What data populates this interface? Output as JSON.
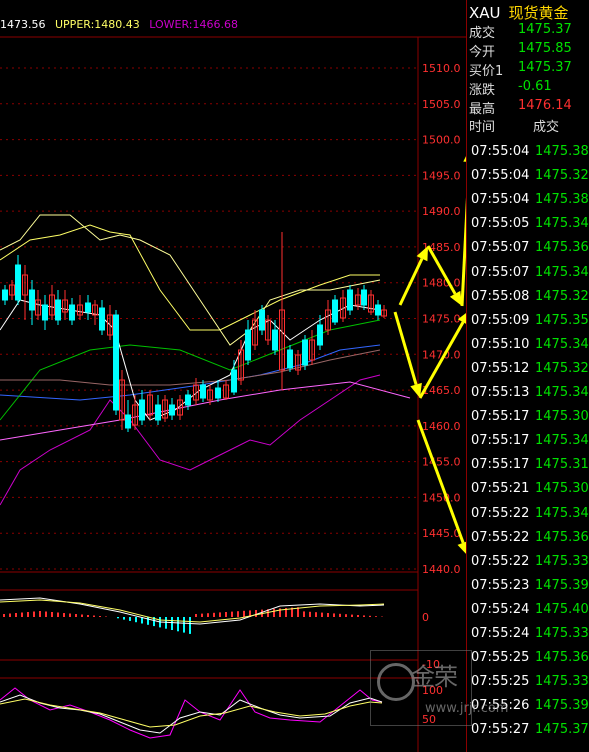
{
  "legend": {
    "mid": "1473.56",
    "upper": "UPPER:1480.43",
    "lower": "LOWER:1466.68"
  },
  "price_axis": [
    "1510.0",
    "1505.0",
    "1500.0",
    "1495.0",
    "1490.0",
    "1485.0",
    "1480.0",
    "1475.0",
    "1470.0",
    "1465.0",
    "1460.0",
    "1455.0",
    "1450.0",
    "1445.0",
    "1440.0"
  ],
  "macd_axis": [
    "0",
    "-10"
  ],
  "kdj_axis": [
    "100",
    "50"
  ],
  "quote": {
    "symbol": "XAU",
    "name": "现货黄金",
    "rows": [
      {
        "label": "成交",
        "value": "1475.37",
        "color": "green"
      },
      {
        "label": "今开",
        "value": "1475.85",
        "color": "green"
      },
      {
        "label": "买价1",
        "value": "1475.37",
        "color": "green"
      },
      {
        "label": "涨跌",
        "value": "-0.61",
        "color": "green"
      },
      {
        "label": "最高",
        "value": "1476.14",
        "color": "red"
      }
    ]
  },
  "trades": {
    "header_time": "时间",
    "header_price": "成交",
    "rows": [
      {
        "time": "07:55:04",
        "price": "1475.38"
      },
      {
        "time": "07:55:04",
        "price": "1475.32"
      },
      {
        "time": "07:55:04",
        "price": "1475.38"
      },
      {
        "time": "07:55:05",
        "price": "1475.34"
      },
      {
        "time": "07:55:07",
        "price": "1475.36"
      },
      {
        "time": "07:55:07",
        "price": "1475.34"
      },
      {
        "time": "07:55:08",
        "price": "1475.32"
      },
      {
        "time": "07:55:09",
        "price": "1475.35"
      },
      {
        "time": "07:55:10",
        "price": "1475.34"
      },
      {
        "time": "07:55:12",
        "price": "1475.32"
      },
      {
        "time": "07:55:13",
        "price": "1475.34"
      },
      {
        "time": "07:55:17",
        "price": "1475.30"
      },
      {
        "time": "07:55:17",
        "price": "1475.34"
      },
      {
        "time": "07:55:17",
        "price": "1475.31"
      },
      {
        "time": "07:55:21",
        "price": "1475.30"
      },
      {
        "time": "07:55:22",
        "price": "1475.34"
      },
      {
        "time": "07:55:22",
        "price": "1475.36"
      },
      {
        "time": "07:55:22",
        "price": "1475.33"
      },
      {
        "time": "07:55:23",
        "price": "1475.39"
      },
      {
        "time": "07:55:24",
        "price": "1475.40"
      },
      {
        "time": "07:55:24",
        "price": "1475.33"
      },
      {
        "time": "07:55:25",
        "price": "1475.36"
      },
      {
        "time": "07:55:25",
        "price": "1475.33"
      },
      {
        "time": "07:55:26",
        "price": "1475.39"
      },
      {
        "time": "07:55:27",
        "price": "1475.37"
      }
    ]
  },
  "watermark": {
    "big": "金荣",
    "small": "www.jrjr.com"
  },
  "colors": {
    "up": "#ff3030",
    "down": "#00ffff",
    "arrow": "#ffff00",
    "grid": "#8b0000",
    "upper_band": "#ffff66",
    "lower_band": "#cc00cc"
  }
}
